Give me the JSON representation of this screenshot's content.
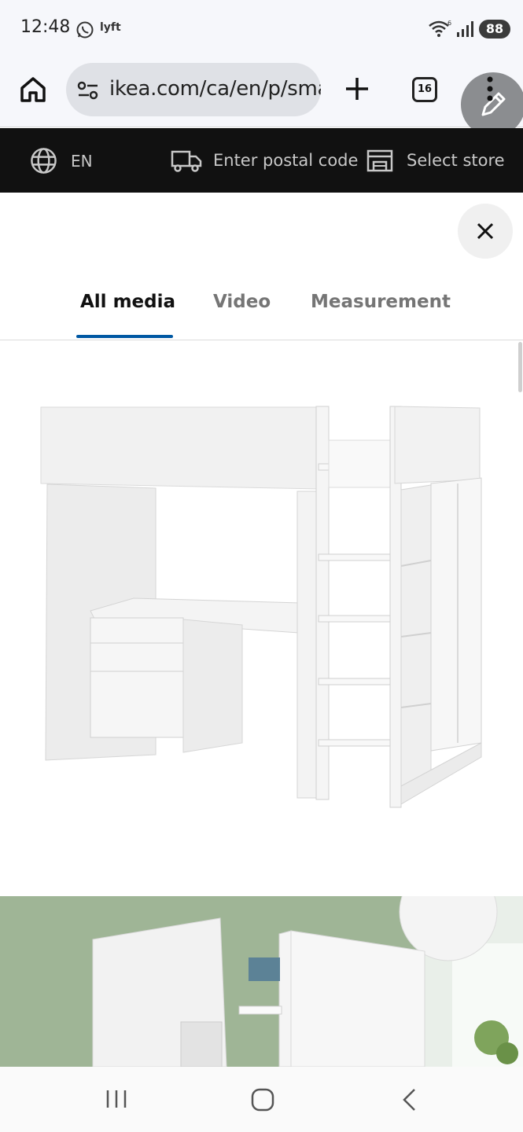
{
  "status_bar": {
    "time": "12:48",
    "app_badge": "lyft",
    "battery": "88"
  },
  "browser": {
    "url": "ikea.com/ca/en/p/sma",
    "tab_count": "16"
  },
  "ikea_header": {
    "language": "EN",
    "postal_code_label": "Enter postal code",
    "store_label": "Select store"
  },
  "media_viewer": {
    "tabs": [
      {
        "label": "All media",
        "active": true
      },
      {
        "label": "Video",
        "active": false
      },
      {
        "label": "Measurement",
        "active": false
      }
    ],
    "accent_color": "#0058a3"
  },
  "icons": [
    "home-icon",
    "site-settings-icon",
    "plus-icon",
    "tabs-icon",
    "kebab-menu-icon",
    "pencil-icon",
    "globe-icon",
    "truck-icon",
    "store-icon",
    "close-icon",
    "recent-apps-icon",
    "nav-home-icon",
    "nav-back-icon"
  ]
}
